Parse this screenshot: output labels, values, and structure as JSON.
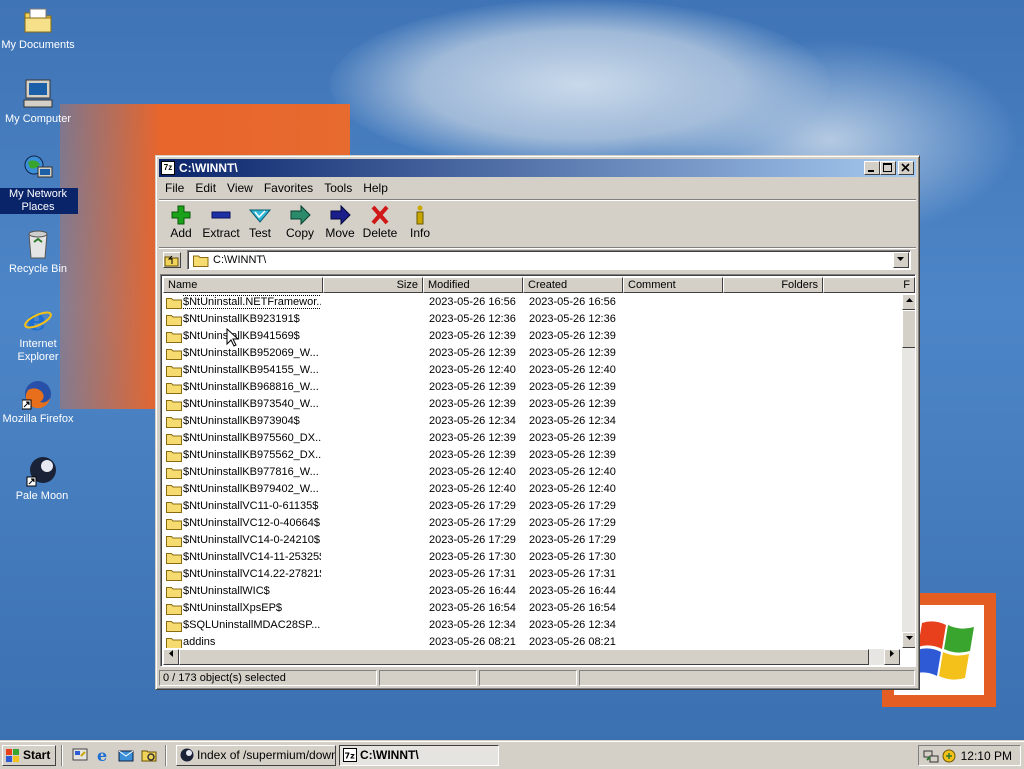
{
  "desktop": {
    "icons": [
      {
        "label": "My Documents",
        "icon": "my-documents-icon"
      },
      {
        "label": "My Computer",
        "icon": "my-computer-icon"
      },
      {
        "label": "My Network Places",
        "icon": "network-places-icon"
      },
      {
        "label": "Recycle Bin",
        "icon": "recycle-bin-icon"
      },
      {
        "label": "Internet Explorer",
        "icon": "internet-explorer-icon"
      },
      {
        "label": "Mozilla Firefox",
        "icon": "firefox-icon"
      },
      {
        "label": "Pale Moon",
        "icon": "pale-moon-icon"
      }
    ]
  },
  "window": {
    "title": "C:\\WINNT\\",
    "title_icon": "7z",
    "menu": [
      "File",
      "Edit",
      "View",
      "Favorites",
      "Tools",
      "Help"
    ],
    "toolbar": [
      {
        "label": "Add",
        "icon": "plus-icon",
        "color": "#1aa31a"
      },
      {
        "label": "Extract",
        "icon": "minus-icon",
        "color": "#1c2fa3"
      },
      {
        "label": "Test",
        "icon": "check-icon",
        "color": "#2fa0c0"
      },
      {
        "label": "Copy",
        "icon": "copy-arrow-icon",
        "color": "#2a8a6a"
      },
      {
        "label": "Move",
        "icon": "move-arrow-icon",
        "color": "#1b1f8a"
      },
      {
        "label": "Delete",
        "icon": "delete-x-icon",
        "color": "#d01818"
      },
      {
        "label": "Info",
        "icon": "info-icon",
        "color": "#c8a800"
      }
    ],
    "address": "C:\\WINNT\\",
    "columns": [
      "Name",
      "Size",
      "Modified",
      "Created",
      "Comment",
      "Folders",
      "F"
    ],
    "rows": [
      {
        "name": "$NtUninstall.NETFramewor...",
        "modified": "2023-05-26 16:56",
        "created": "2023-05-26 16:56"
      },
      {
        "name": "$NtUninstallKB923191$",
        "modified": "2023-05-26 12:36",
        "created": "2023-05-26 12:36"
      },
      {
        "name": "$NtUninstallKB941569$",
        "modified": "2023-05-26 12:39",
        "created": "2023-05-26 12:39"
      },
      {
        "name": "$NtUninstallKB952069_W...",
        "modified": "2023-05-26 12:39",
        "created": "2023-05-26 12:39"
      },
      {
        "name": "$NtUninstallKB954155_W...",
        "modified": "2023-05-26 12:40",
        "created": "2023-05-26 12:40"
      },
      {
        "name": "$NtUninstallKB968816_W...",
        "modified": "2023-05-26 12:39",
        "created": "2023-05-26 12:39"
      },
      {
        "name": "$NtUninstallKB973540_W...",
        "modified": "2023-05-26 12:39",
        "created": "2023-05-26 12:39"
      },
      {
        "name": "$NtUninstallKB973904$",
        "modified": "2023-05-26 12:34",
        "created": "2023-05-26 12:34"
      },
      {
        "name": "$NtUninstallKB975560_DX...",
        "modified": "2023-05-26 12:39",
        "created": "2023-05-26 12:39"
      },
      {
        "name": "$NtUninstallKB975562_DX...",
        "modified": "2023-05-26 12:39",
        "created": "2023-05-26 12:39"
      },
      {
        "name": "$NtUninstallKB977816_W...",
        "modified": "2023-05-26 12:40",
        "created": "2023-05-26 12:40"
      },
      {
        "name": "$NtUninstallKB979402_W...",
        "modified": "2023-05-26 12:40",
        "created": "2023-05-26 12:40"
      },
      {
        "name": "$NtUninstallVC11-0-61135$",
        "modified": "2023-05-26 17:29",
        "created": "2023-05-26 17:29"
      },
      {
        "name": "$NtUninstallVC12-0-40664$",
        "modified": "2023-05-26 17:29",
        "created": "2023-05-26 17:29"
      },
      {
        "name": "$NtUninstallVC14-0-24210$",
        "modified": "2023-05-26 17:29",
        "created": "2023-05-26 17:29"
      },
      {
        "name": "$NtUninstallVC14-11-25325$",
        "modified": "2023-05-26 17:30",
        "created": "2023-05-26 17:30"
      },
      {
        "name": "$NtUninstallVC14.22-27821$",
        "modified": "2023-05-26 17:31",
        "created": "2023-05-26 17:31"
      },
      {
        "name": "$NtUninstallWIC$",
        "modified": "2023-05-26 16:44",
        "created": "2023-05-26 16:44"
      },
      {
        "name": "$NtUninstallXpsEP$",
        "modified": "2023-05-26 16:54",
        "created": "2023-05-26 16:54"
      },
      {
        "name": "$SQLUninstallMDAC28SP...",
        "modified": "2023-05-26 12:34",
        "created": "2023-05-26 12:34"
      },
      {
        "name": "addins",
        "modified": "2023-05-26 08:21",
        "created": "2023-05-26 08:21"
      }
    ],
    "status": [
      "0 / 173 object(s) selected",
      "",
      "",
      ""
    ]
  },
  "taskbar": {
    "start_label": "Start",
    "tasks": [
      {
        "label": "Index of /supermium/down...",
        "icon": "pale-moon-icon",
        "active": false
      },
      {
        "label": "C:\\WINNT\\",
        "icon": "7z-icon",
        "active": true
      }
    ],
    "clock": "12:10 PM"
  },
  "colors": {
    "title_active_start": "#0a246a",
    "title_active_end": "#a6caf0",
    "chrome": "#d4d0c8",
    "desktop_blue": "#3f74b6",
    "wallpaper_orange": "#e8652b"
  }
}
